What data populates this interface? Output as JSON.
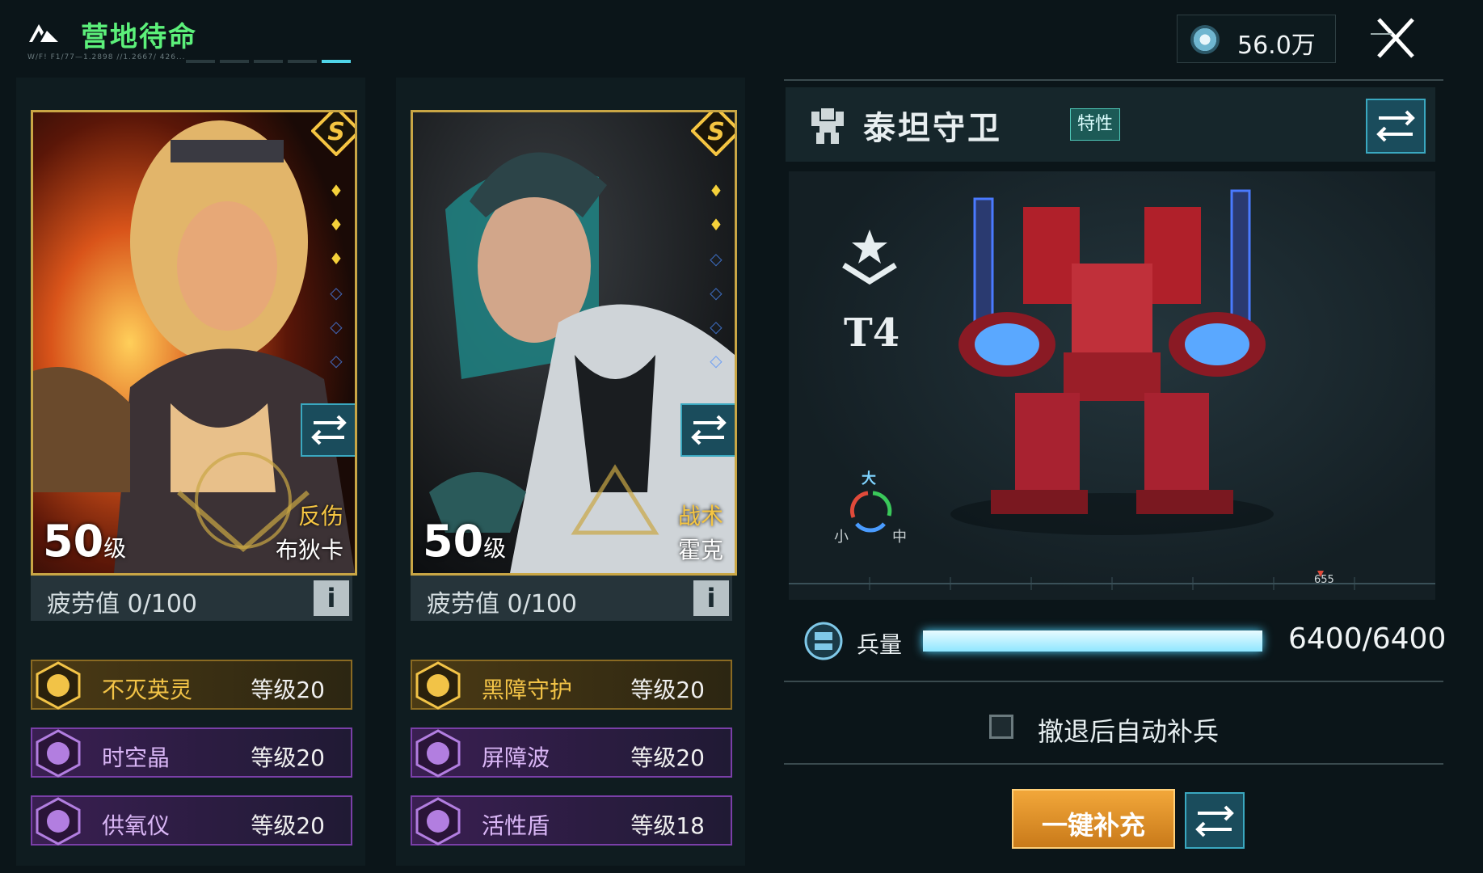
{
  "header": {
    "title": "营地待命",
    "subline": "W/F! F1/77—1.2898 //1.2667/ 426...",
    "currency_value": "56.0万"
  },
  "heroes": [
    {
      "level": "50",
      "level_unit": "级",
      "role": "反伤",
      "name": "布狄卡",
      "rank": "S",
      "stars_filled": 3,
      "stars_total": 6,
      "fatigue": "疲劳值 0/100",
      "skills": [
        {
          "name": "不灭英灵",
          "level": "等级20",
          "tier": "gold"
        },
        {
          "name": "时空晶",
          "level": "等级20",
          "tier": "purple"
        },
        {
          "name": "供氧仪",
          "level": "等级20",
          "tier": "purple"
        }
      ]
    },
    {
      "level": "50",
      "level_unit": "级",
      "role": "战术",
      "name": "霍克",
      "rank": "S",
      "stars_filled": 2,
      "stars_total": 6,
      "fatigue": "疲劳值 0/100",
      "skills": [
        {
          "name": "黑障守护",
          "level": "等级20",
          "tier": "gold"
        },
        {
          "name": "屏障波",
          "level": "等级20",
          "tier": "purple"
        },
        {
          "name": "活性盾",
          "level": "等级18",
          "tier": "purple"
        }
      ]
    }
  ],
  "mech": {
    "name": "泰坦守卫",
    "trait_label": "特性",
    "tier": "T4",
    "cycle_labels": {
      "big": "大",
      "small": "小",
      "mid": "中"
    },
    "ruler_mark": "655",
    "troops_label": "兵量",
    "troops_value": "6400/6400",
    "troops_current": 6400,
    "troops_max": 6400
  },
  "auto_refill_label": "撤退后自动补兵",
  "auto_refill_checked": false,
  "supply_button_label": "一键补充",
  "colors": {
    "accent": "#4fd4e8",
    "title_green": "#5cf07a",
    "gold": "#c9a645",
    "purple": "#7a3fa8",
    "orange": "#f2a73a"
  }
}
